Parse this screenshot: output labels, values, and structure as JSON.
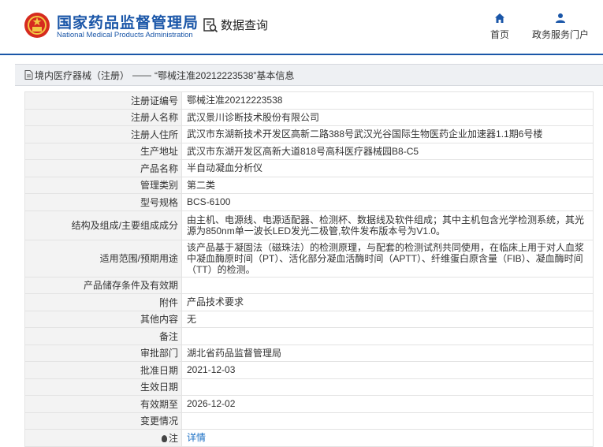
{
  "header": {
    "brand_cn": "国家药品监督管理局",
    "brand_en": "National Medical Products Administration",
    "query_label": "数据查询",
    "nav": {
      "home_label": "首页",
      "portal_label": "政务服务门户"
    }
  },
  "breadcrumb": {
    "category": "境内医疗器械（注册）",
    "separator": "——",
    "title": "“鄂械注准20212223538”基本信息"
  },
  "details": [
    {
      "label": "注册证编号",
      "value": "鄂械注准20212223538"
    },
    {
      "label": "注册人名称",
      "value": "武汉景川诊断技术股份有限公司"
    },
    {
      "label": "注册人住所",
      "value": "武汉市东湖新技术开发区高新二路388号武汉光谷国际生物医药企业加速器1.1期6号楼"
    },
    {
      "label": "生产地址",
      "value": "武汉市东湖开发区高新大道818号高科医疗器械园B8-C5"
    },
    {
      "label": "产品名称",
      "value": "半自动凝血分析仪"
    },
    {
      "label": "管理类别",
      "value": "第二类"
    },
    {
      "label": "型号规格",
      "value": "BCS-6100"
    },
    {
      "label": "结构及组成/主要组成成分",
      "value": "由主机、电源线、电源适配器、检测杯、数据线及软件组成；其中主机包含光学检测系统，其光源为850nm单一波长LED发光二极管,软件发布版本号为V1.0。"
    },
    {
      "label": "适用范围/预期用途",
      "value": "该产品基于凝固法（磁珠法）的检测原理，与配套的检测试剂共同使用，在临床上用于对人血浆中凝血酶原时间（PT）、活化部分凝血活酶时间（APTT）、纤维蛋白原含量（FIB）、凝血酶时间（TT）的检测。"
    },
    {
      "label": "产品储存条件及有效期",
      "value": ""
    },
    {
      "label": "附件",
      "value": "产品技术要求"
    },
    {
      "label": "其他内容",
      "value": "无"
    },
    {
      "label": "备注",
      "value": ""
    },
    {
      "label": "审批部门",
      "value": "湖北省药品监督管理局"
    },
    {
      "label": "批准日期",
      "value": "2021-12-03"
    },
    {
      "label": "生效日期",
      "value": ""
    },
    {
      "label": "有效期至",
      "value": "2026-12-02"
    },
    {
      "label": "变更情况",
      "value": ""
    },
    {
      "label": "注",
      "value": "详情"
    }
  ],
  "colors": {
    "brand_blue": "#1a56a8",
    "link_blue": "#1a6fc4"
  }
}
